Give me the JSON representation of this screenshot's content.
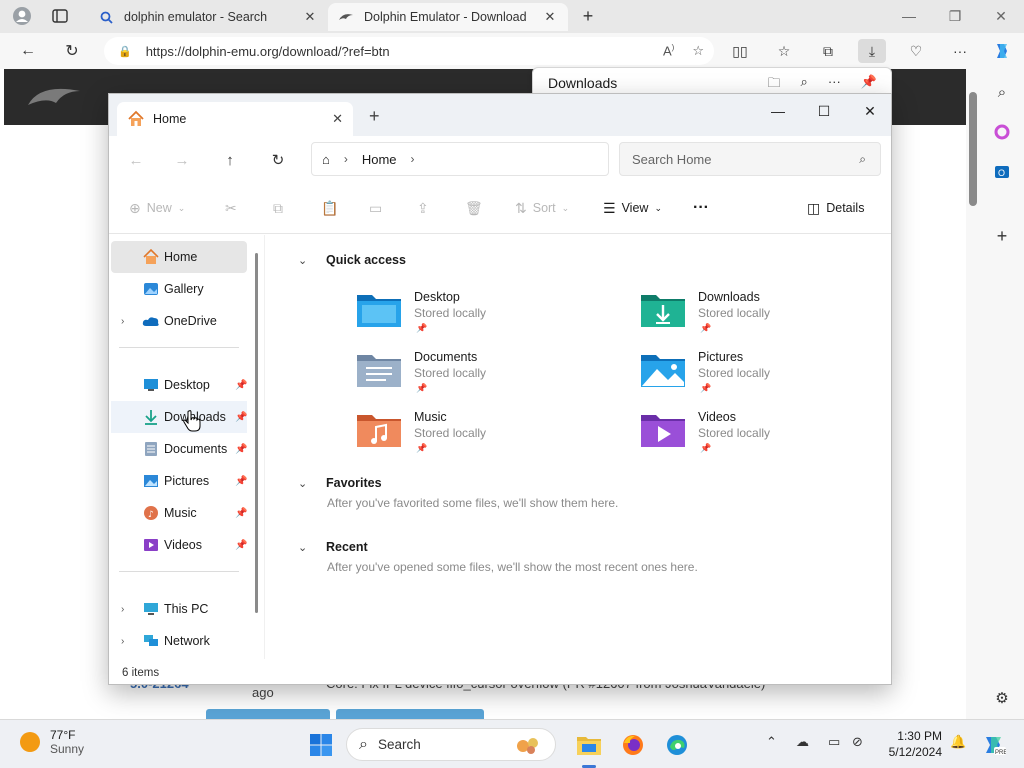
{
  "browser": {
    "tabs": [
      {
        "title": "dolphin emulator - Search",
        "favicon": "search-icon"
      },
      {
        "title": "Dolphin Emulator - Download",
        "favicon": "dolphin-icon"
      }
    ],
    "url": "https://dolphin-emu.org/download/?ref=btn",
    "downloads_panel_title": "Downloads"
  },
  "page_fragments": {
    "time_ago": "ago",
    "version": "5.0-21264",
    "commit_text": "Core: Fix IPL device fifo_cursor overflow (PR #12607 from JoshuaVandaele)"
  },
  "explorer": {
    "tab_title": "Home",
    "breadcrumb": "Home",
    "search_placeholder": "Search Home",
    "commands": {
      "new": "New",
      "sort": "Sort",
      "view": "View",
      "details": "Details"
    },
    "nav": [
      {
        "label": "Home"
      },
      {
        "label": "Gallery"
      },
      {
        "label": "OneDrive"
      },
      {
        "label": "Desktop"
      },
      {
        "label": "Downloads"
      },
      {
        "label": "Documents"
      },
      {
        "label": "Pictures"
      },
      {
        "label": "Music"
      },
      {
        "label": "Videos"
      },
      {
        "label": "This PC"
      },
      {
        "label": "Network"
      }
    ],
    "status": "6 items",
    "sections": {
      "quick_access": "Quick access",
      "favorites": "Favorites",
      "favorites_note": "After you've favorited some files, we'll show them here.",
      "recent": "Recent",
      "recent_note": "After you've opened some files, we'll show the most recent ones here."
    },
    "quick_access": [
      {
        "name": "Desktop",
        "sub": "Stored locally"
      },
      {
        "name": "Downloads",
        "sub": "Stored locally"
      },
      {
        "name": "Documents",
        "sub": "Stored locally"
      },
      {
        "name": "Pictures",
        "sub": "Stored locally"
      },
      {
        "name": "Music",
        "sub": "Stored locally"
      },
      {
        "name": "Videos",
        "sub": "Stored locally"
      }
    ]
  },
  "taskbar": {
    "temp": "77°F",
    "condition": "Sunny",
    "search_label": "Search",
    "time": "1:30 PM",
    "date": "5/12/2024"
  },
  "colors": {
    "accent": "#3b77d6",
    "weather_sun": "#f39a12",
    "folder_blue": "#1f8fd8",
    "folder_teal": "#18a28a"
  }
}
